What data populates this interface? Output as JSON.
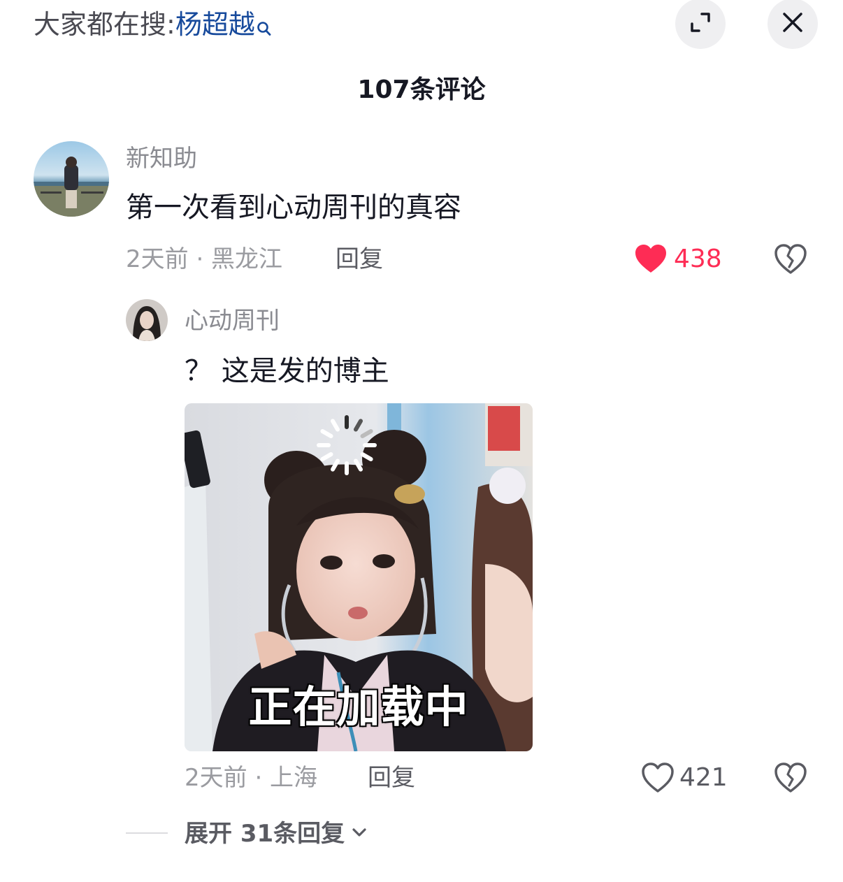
{
  "header": {
    "search_prefix": "大家都在搜:",
    "search_keyword": "杨超越",
    "comment_count_title": "107条评论"
  },
  "comments": [
    {
      "username": "新知助",
      "text": "第一次看到心动周刊的真容",
      "meta": "2天前 · 黑龙江",
      "reply_label": "回复",
      "likes": "438",
      "liked": true,
      "replies": [
        {
          "username": "心动周刊",
          "text": "？ 这是发的博主",
          "sticker_caption": "正在加载中",
          "meta": "2天前 · 上海",
          "reply_label": "回复",
          "likes": "421",
          "liked": false
        }
      ],
      "expand_label": "展开 31条回复"
    }
  ],
  "colors": {
    "liked_red": "#fe2c55",
    "keyword_blue": "#174a9c",
    "muted_gray": "#9a9ba0"
  },
  "icons": [
    "search-icon",
    "expand-icon",
    "close-icon",
    "heart-filled-icon",
    "heart-outline-icon",
    "broken-heart-icon",
    "chevron-down-icon",
    "loading-spinner-icon"
  ]
}
